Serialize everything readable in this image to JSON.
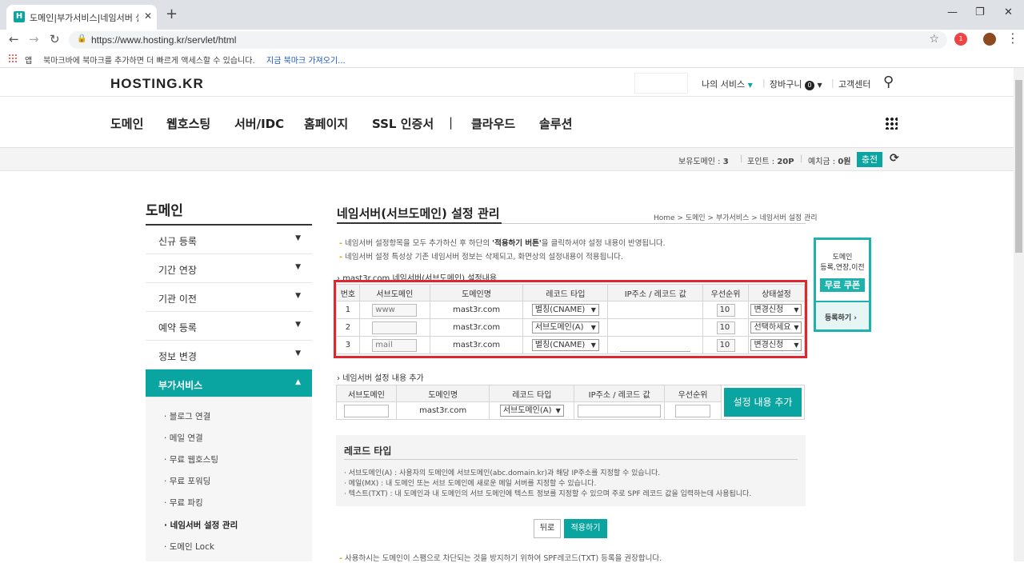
{
  "browser": {
    "tab_title": "도메인|부가서비스|네임서버 설정",
    "tab_icon_letter": "H",
    "url": "https://www.hosting.kr/servlet/html",
    "bookmarks_apps": "앱",
    "bookmarks_text": "북마크바에 북마크를 추가하면 더 빠르게 액세스할 수 있습니다.",
    "bookmarks_link": "지금 북마크 가져오기...",
    "ext_badge": "1"
  },
  "site": {
    "logo": "HOSTING.KR",
    "util": {
      "my_service": "나의 서비스",
      "cart": "장바구니",
      "cart_count": "0",
      "support": "고객센터"
    },
    "gnb": [
      "도메인",
      "웹호스팅",
      "서버/IDC",
      "홈페이지",
      "SSL 인증서",
      "|",
      "클라우드",
      "솔루션"
    ],
    "status": {
      "domains_label": "보유도메인 :",
      "domains_value": "3",
      "points_label": "포인트 :",
      "points_value": "20P",
      "deposit_label": "예치금 :",
      "deposit_value": "0원",
      "charge": "충전"
    }
  },
  "lnb": {
    "title": "도메인",
    "items": [
      "신규 등록",
      "기간 연장",
      "기관 이전",
      "예약 등록",
      "정보 변경",
      "부가서비스"
    ],
    "sub": [
      "블로그 연결",
      "메일 연결",
      "무료 웹호스팅",
      "무료 포워딩",
      "무료 파킹",
      "네임서버 설정 관리",
      "도메인 Lock"
    ]
  },
  "content": {
    "title": "네임서버(서브도메인) 설정 관리",
    "breadcrumb": "Home > 도메인 > 부가서비스 > 네임서버 설정 관리",
    "notes": [
      [
        "네임서버 설정항목을 모두 추가하신 후 하단의 ",
        "'적용하기 버튼'",
        "을 클릭하셔야 설정 내용이 반영됩니다."
      ],
      [
        "네임서버 설정 특성상 기존 네임서버 정보는 삭제되고, 화면상의 설정내용이 적용됩니다.",
        "",
        ""
      ]
    ],
    "current_section": "mast3r.com 네임서버(서브도메인) 설정내용",
    "table_headers": [
      "번호",
      "서브도메인",
      "도메인명",
      "레코드 타입",
      "IP주소 / 레코드 값",
      "우선순위",
      "상태설정"
    ],
    "rows": [
      {
        "no": "1",
        "sub": "www",
        "domain": "mast3r.com",
        "type": "별칭(CNAME)",
        "ip": "",
        "priority": "10",
        "status": "변경신청"
      },
      {
        "no": "2",
        "sub": "",
        "domain": "mast3r.com",
        "type": "서브도메인(A)",
        "ip": "",
        "priority": "10",
        "status": "선택하세요"
      },
      {
        "no": "3",
        "sub": "mail",
        "domain": "mast3r.com",
        "type": "별칭(CNAME)",
        "ip": "",
        "priority": "10",
        "status": "변경신청"
      }
    ],
    "add_section": "네임서버 설정 내용 추가",
    "add_headers": [
      "서브도메인",
      "도메인명",
      "레코드 타입",
      "IP주소 / 레코드 값",
      "우선순위"
    ],
    "add_row": {
      "sub": "",
      "domain": "mast3r.com",
      "type": "서브도메인(A)",
      "ip": "",
      "priority": ""
    },
    "add_button": "설정 내용 추가",
    "record_types_title": "레코드 타입",
    "record_types": [
      "· 서브도메인(A) : 사용자의 도메인에 서브도메인(abc.domain.kr)과 해당 IP주소를 지정할 수 있습니다.",
      "· 메일(MX) : 내 도메인 또는 서브 도메인에 새로운 메일 서버를 지정할 수 있습니다.",
      "· 텍스트(TXT) : 내 도메인과 내 도메인의 서브 도메인에 텍스트 정보를 지정할 수 있으며 주로 SPF 레코드 값을 입력하는데 사용됩니다."
    ],
    "back_button": "뒤로",
    "apply_button": "적용하기",
    "bottom_note": "사용하시는 도메인이 스팸으로 차단되는 것을 방지하기 위하여 SPF레코드(TXT) 등록을 권장합니다."
  },
  "coupon": {
    "line1": "도메인",
    "line2": "등록,연장,이전",
    "badge": "무료 쿠폰",
    "cta": "등록하기 ›"
  },
  "colors": {
    "accent": "#0aa5a0",
    "highlight": "#e0262e"
  }
}
